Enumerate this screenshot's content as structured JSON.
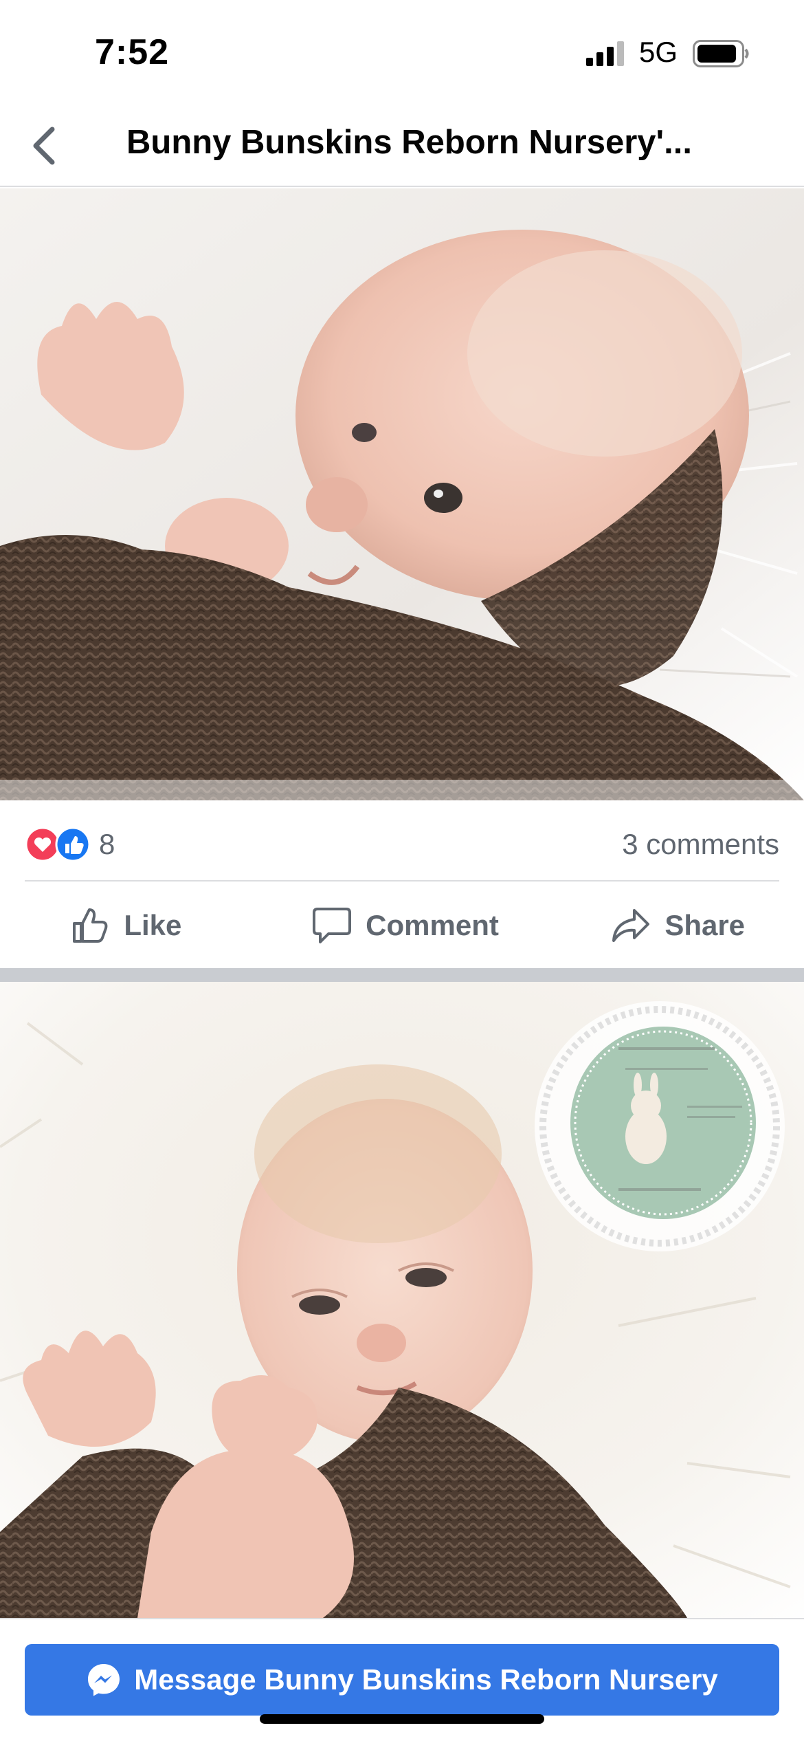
{
  "status_bar": {
    "time": "7:52",
    "network": "5G",
    "signal_icon": "cellular-signal-icon",
    "battery_icon": "battery-icon"
  },
  "header": {
    "back_icon": "chevron-left-icon",
    "title": "Bunny Bunskins Reborn Nursery'..."
  },
  "post": {
    "photo_1": "reborn baby doll swaddled in brown knit wrap on white fur",
    "reactions": {
      "icons": [
        "love-reaction-icon",
        "like-reaction-icon"
      ],
      "count": "8",
      "comments": "3 comments"
    },
    "actions": {
      "like": "Like",
      "comment": "Comment",
      "share": "Share"
    },
    "photo_2_watermark": "Bunny Bunskins Reborn Nursery — Angel"
  },
  "bottom_bar": {
    "message_button": "Message Bunny Bunskins Reborn Nursery",
    "messenger_icon": "messenger-icon"
  },
  "colors": {
    "accent": "#3578e5",
    "love": "#f33e58",
    "like": "#1877f2",
    "muted_text": "#606770"
  }
}
